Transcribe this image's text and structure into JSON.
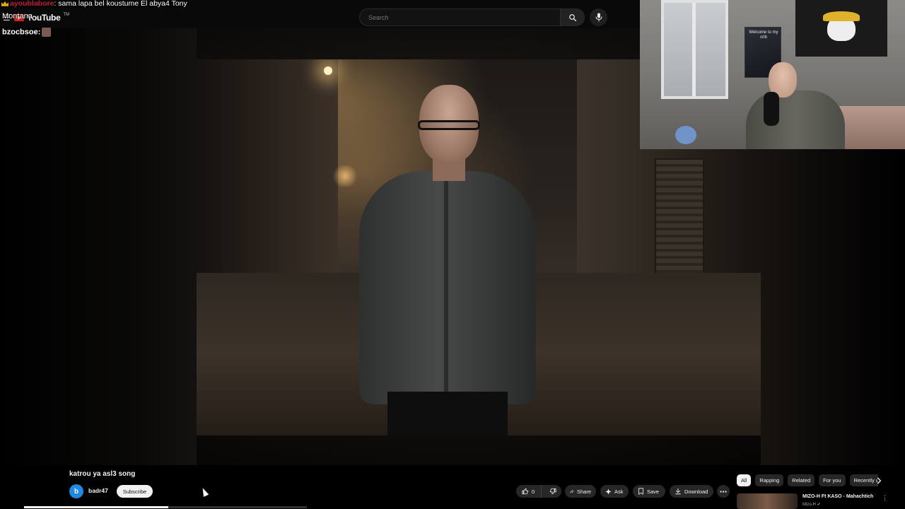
{
  "chat": {
    "top_user": "ayoublabore",
    "top_message": ": sama lapa bel koustume El abya4 Tony",
    "line2_text": "Montana",
    "line3_user": "bzocbsoe:"
  },
  "header": {
    "logo_text": "YouTube",
    "logo_tm": "TM",
    "search_placeholder": "Search"
  },
  "webcam": {
    "poster_text": "Welcome to my crib"
  },
  "video": {
    "title": "katrou ya asl3 song",
    "channel_initial": "b",
    "channel_name": "badr47",
    "subscribe_label": "Subscribe",
    "progress_fraction": 0.51
  },
  "actions": {
    "like_count": "0",
    "share_label": "Share",
    "ask_label": "Ask",
    "save_label": "Save",
    "download_label": "Download"
  },
  "chips": [
    "All",
    "Rapping",
    "Related",
    "For you",
    "Recently uploaded"
  ],
  "recommendation": {
    "title": "MIZO-H Ft KASO - Mahachtich",
    "channel": "Mizo-H"
  },
  "colors": {
    "accent_red": "#e62117",
    "chat_user_red": "#c21d3c",
    "avatar_blue": "#1e88e5"
  }
}
